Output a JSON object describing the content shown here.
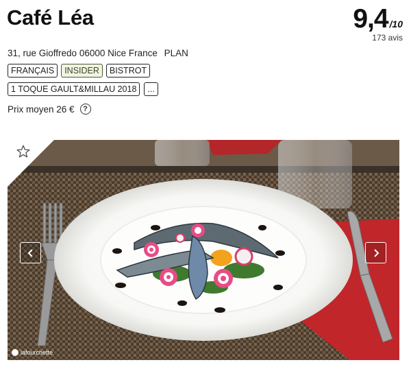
{
  "restaurant": {
    "name": "Café Léa",
    "rating": {
      "score": "9,4",
      "scale": "/10",
      "reviews": "173 avis"
    },
    "address": "31, rue Gioffredo 06000 Nice France",
    "plan_label": "PLAN",
    "tags_row1": [
      "FRANÇAIS",
      "INSIDER",
      "BISTROT"
    ],
    "tags_row2": [
      "1 TOQUE GAULT&MILLAU 2018",
      "..."
    ],
    "price": "Prix moyen 26 €",
    "help_glyph": "?"
  },
  "gallery": {
    "watermark": "lafourchette",
    "icons": {
      "favorite": "star-icon",
      "prev": "chevron-left-icon",
      "next": "chevron-right-icon",
      "help": "question-circle-icon"
    }
  },
  "colors": {
    "napkin": "#c0262a",
    "placemat": "#5a4a38",
    "plate": "#fbfbfb"
  }
}
